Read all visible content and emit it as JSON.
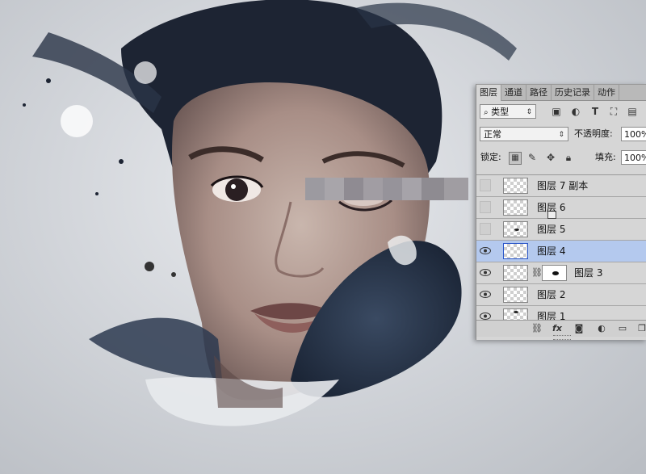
{
  "panel": {
    "tabs": [
      "图层",
      "通道",
      "路径",
      "历史记录",
      "动作"
    ],
    "active_tab": "图层",
    "filter": {
      "label": "类型",
      "icon": "search-icon"
    },
    "filter_icons": [
      "image-filter-icon",
      "adjustment-filter-icon",
      "type-filter-icon",
      "shape-filter-icon",
      "smart-object-filter-icon"
    ],
    "blend_mode": "正常",
    "opacity_label": "不透明度:",
    "opacity_value": "100%",
    "lock_label": "锁定:",
    "lock_icons": [
      "lock-transparent-pixels-icon",
      "lock-image-pixels-icon",
      "lock-position-icon",
      "lock-all-icon"
    ],
    "fill_label": "填充:",
    "fill_value": "100%",
    "layers": [
      {
        "name": "图层 7 副本",
        "visible": false,
        "selected": false
      },
      {
        "name": "图层 6",
        "visible": false,
        "selected": false,
        "smart_object": true
      },
      {
        "name": "图层 5",
        "visible": false,
        "selected": false
      },
      {
        "name": "图层 4",
        "visible": true,
        "selected": true
      },
      {
        "name": "图层 3",
        "visible": true,
        "selected": false,
        "has_mask": true
      },
      {
        "name": "图层 2",
        "visible": true,
        "selected": false
      },
      {
        "name": "图层 1",
        "visible": true,
        "selected": false
      }
    ],
    "footer_icons": [
      "link-layers-icon",
      "fx-icon",
      "add-mask-icon",
      "adjustment-layer-icon",
      "new-group-icon",
      "new-layer-icon"
    ],
    "fx_label": "fx"
  },
  "colors": {
    "selected_row": "#b4c9ee",
    "panel_bg": "#d6d6d6",
    "ink": "#1e2a3a"
  }
}
